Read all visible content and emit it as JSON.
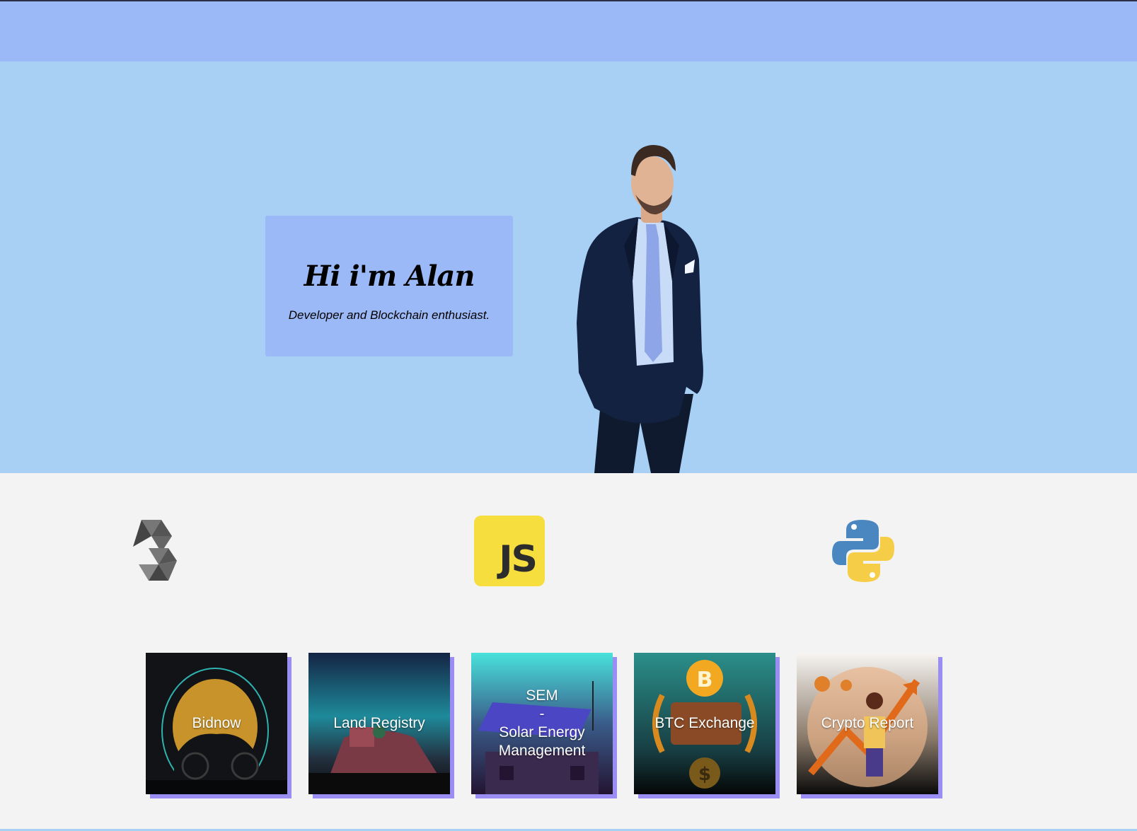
{
  "hero": {
    "title": "Hi i'm Alan",
    "subtitle": "Developer and Blockchain enthusiast."
  },
  "tech_icons": [
    {
      "name": "solidity-icon"
    },
    {
      "name": "javascript-icon",
      "label": "JS"
    },
    {
      "name": "python-icon"
    }
  ],
  "projects": [
    {
      "label": "Bidnow"
    },
    {
      "label": "Land Registry"
    },
    {
      "label": "SEM\n-\nSolar Energy\nManagement"
    },
    {
      "label": "BTC Exchange"
    },
    {
      "label": "Crypto Report"
    }
  ],
  "colors": {
    "navbar": "#9cb9f7",
    "hero_background": "#a8cff4",
    "card_shadow": "#9a8ef5",
    "page_background": "#f3f3f3"
  }
}
